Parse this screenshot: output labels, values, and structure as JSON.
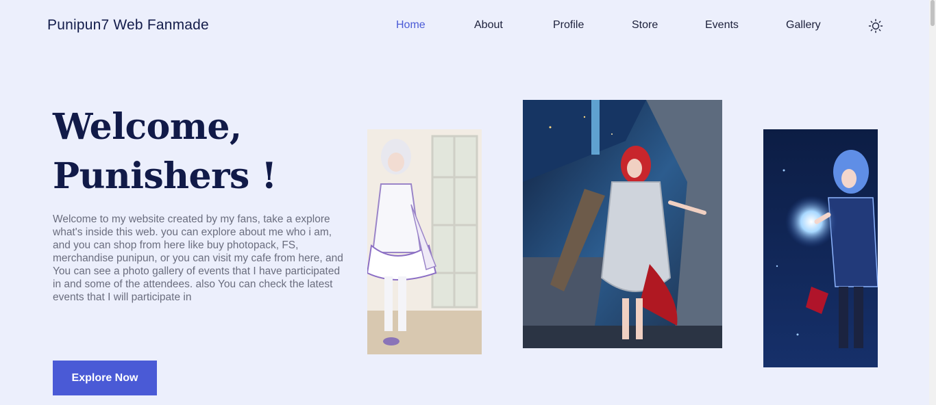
{
  "nav": {
    "brand": "Punipun7 Web Fanmade",
    "items": [
      {
        "label": "Home",
        "active": true
      },
      {
        "label": "About",
        "active": false
      },
      {
        "label": "Profile",
        "active": false
      },
      {
        "label": "Store",
        "active": false
      },
      {
        "label": "Events",
        "active": false
      },
      {
        "label": "Gallery",
        "active": false
      }
    ],
    "theme_icon": "sun-icon"
  },
  "hero": {
    "title_line1": "Welcome,",
    "title_line2": "Punishers !",
    "description": "Welcome to my website created by my fans, take a explore what's inside this web. you can explore about me who i am, and you can shop from here like buy photopack, FS, merchandise punipun, or you can visit my cafe from here, and You can see a photo gallery of events that I have participated in and some of the attendees. also You can check the latest events that I will participate in",
    "cta_label": "Explore Now"
  },
  "colors": {
    "background": "#eceffc",
    "accent": "#4a5ad6",
    "heading": "#111a48",
    "body_text": "#6a6d7e"
  }
}
